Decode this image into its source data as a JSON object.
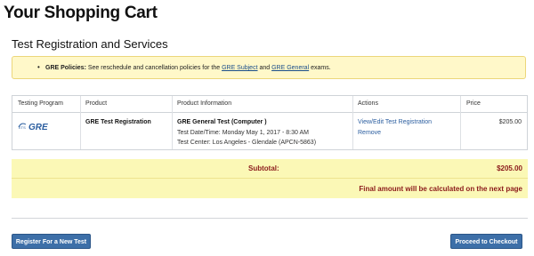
{
  "page": {
    "title": "Your Shopping Cart"
  },
  "section": {
    "title": "Test Registration and Services"
  },
  "notice": {
    "bullet": "•",
    "label": "GRE Policies:",
    "text_before": " See reschedule and cancellation policies for the ",
    "link_subject": "GRE Subject",
    "text_and": " and ",
    "link_general": "GRE General",
    "text_after": " exams."
  },
  "table": {
    "headers": {
      "testing_program": "Testing Program",
      "product": "Product",
      "product_information": "Product Information",
      "actions": "Actions",
      "price": "Price"
    },
    "row": {
      "logo_prefix": "ETS",
      "logo_text": "GRE",
      "product": "GRE Test Registration",
      "info_title": "GRE General Test (Computer )",
      "info_date": "Test Date/Time: Monday May 1, 2017 - 8:30 AM",
      "info_center": "Test Center: Los Angeles - Glendale (APCN-5863)",
      "action_edit": "View/Edit Test Registration",
      "action_remove": "Remove",
      "price": "$205.00"
    }
  },
  "summary": {
    "subtotal_label": "Subtotal:",
    "subtotal_value": "$205.00",
    "final_note": "Final amount will be calculated on the next page"
  },
  "buttons": {
    "register_new": "Register For a New Test",
    "checkout": "Proceed to Checkout"
  },
  "colors": {
    "notice_bg": "#fff8c9",
    "summary_bg": "#fbf8b6",
    "accent_red": "#8b1a1a",
    "button_blue": "#3d6fa8",
    "link_blue": "#2a5d9f"
  }
}
